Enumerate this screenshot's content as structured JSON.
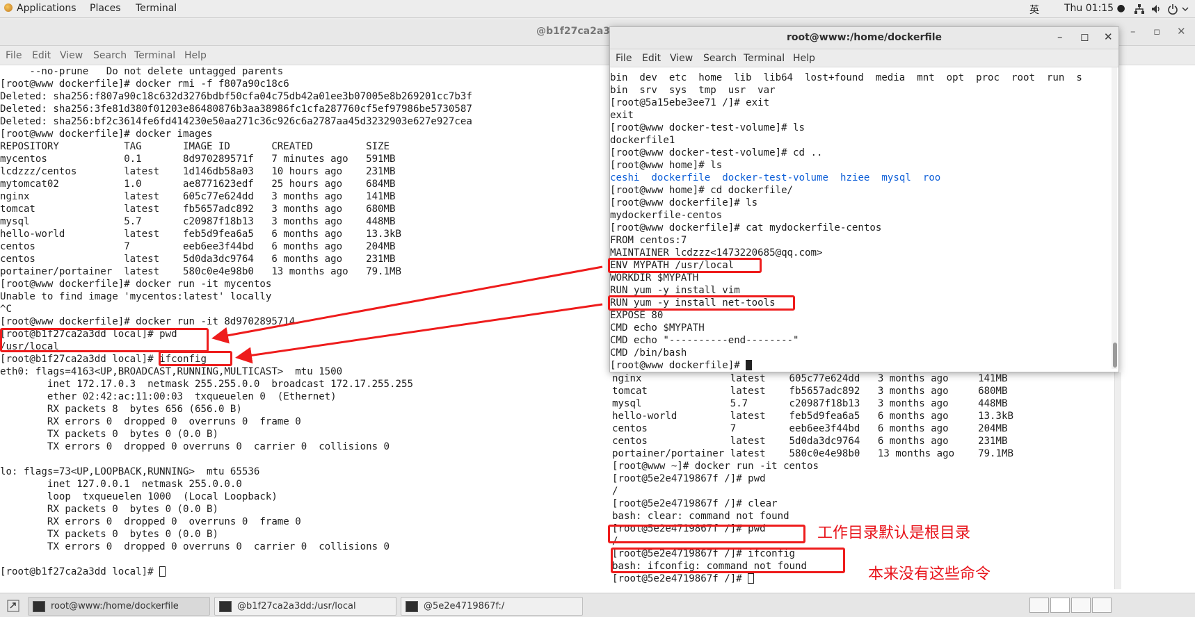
{
  "top_panel": {
    "applications": "Applications",
    "places": "Places",
    "terminal": "Terminal",
    "input_method": "英",
    "clock": "Thu 01:15 ●"
  },
  "main_window": {
    "title": "@b1f27ca2a3dd:/usr/local",
    "title_visible": "@b1f27ca2a3dd",
    "menu": [
      "File",
      "Edit",
      "View",
      "Search",
      "Terminal",
      "Help"
    ],
    "lines": [
      "     --no-prune   Do not delete untagged parents",
      "[root@www dockerfile]# docker rmi -f f807a90c18c6",
      "Deleted: sha256:f807a90c18c632d3276bdbf50cfa04c75db42a01ee3b07005e8b269201cc7b3f",
      "Deleted: sha256:3fe81d380f01203e86480876b3aa38986fc1cfa287760cf5ef97986be5730587",
      "Deleted: sha256:bf2c3614fe6fd414230e50aa271c36c926c6a2787aa45d3232903e627e927cea",
      "[root@www dockerfile]# docker images",
      "REPOSITORY           TAG       IMAGE ID       CREATED         SIZE",
      "mycentos             0.1       8d970289571f   7 minutes ago   591MB",
      "lcdzzz/centos        latest    1d146db58a03   10 hours ago    231MB",
      "mytomcat02           1.0       ae8771623edf   25 hours ago    684MB",
      "nginx                latest    605c77e624dd   3 months ago    141MB",
      "tomcat               latest    fb5657adc892   3 months ago    680MB",
      "mysql                5.7       c20987f18b13   3 months ago    448MB",
      "hello-world          latest    feb5d9fea6a5   6 months ago    13.3kB",
      "centos               7         eeb6ee3f44bd   6 months ago    204MB",
      "centos               latest    5d0da3dc9764   6 months ago    231MB",
      "portainer/portainer  latest    580c0e4e98b0   13 months ago   79.1MB",
      "[root@www dockerfile]# docker run -it mycentos",
      "Unable to find image 'mycentos:latest' locally",
      "^C",
      "[root@www dockerfile]# docker run -it 8d9702895714",
      "[root@b1f27ca2a3dd local]# pwd",
      "/usr/local",
      "[root@b1f27ca2a3dd local]# ifconfig",
      "eth0: flags=4163<UP,BROADCAST,RUNNING,MULTICAST>  mtu 1500",
      "        inet 172.17.0.3  netmask 255.255.0.0  broadcast 172.17.255.255",
      "        ether 02:42:ac:11:00:03  txqueuelen 0  (Ethernet)",
      "        RX packets 8  bytes 656 (656.0 B)",
      "        RX errors 0  dropped 0  overruns 0  frame 0",
      "        TX packets 0  bytes 0 (0.0 B)",
      "        TX errors 0  dropped 0 overruns 0  carrier 0  collisions 0",
      "",
      "lo: flags=73<UP,LOOPBACK,RUNNING>  mtu 65536",
      "        inet 127.0.0.1  netmask 255.0.0.0",
      "        loop  txqueuelen 1000  (Local Loopback)",
      "        RX packets 0  bytes 0 (0.0 B)",
      "        RX errors 0  dropped 0  overruns 0  frame 0",
      "        TX packets 0  bytes 0 (0.0 B)",
      "        TX errors 0  dropped 0 overruns 0  carrier 0  collisions 0",
      "",
      "[root@b1f27ca2a3dd local]# "
    ]
  },
  "dockerfile_window": {
    "title": "root@www:/home/dockerfile",
    "menu": [
      "File",
      "Edit",
      "View",
      "Search",
      "Terminal",
      "Help"
    ],
    "lines_before": [
      "bin  dev  etc  home  lib  lib64  lost+found  media  mnt  opt  proc  root  run  s",
      "bin  srv  sys  tmp  usr  var",
      "[root@5a15ebe3ee71 /]# exit",
      "exit",
      "[root@www docker-test-volume]# ls",
      "dockerfile1",
      "[root@www docker-test-volume]# cd ..",
      "[root@www home]# ls"
    ],
    "ls_home": [
      "ceshi",
      "dockerfile",
      "docker-test-volume",
      "hziee",
      "mysql",
      "roo"
    ],
    "lines_after": [
      "[root@www home]# cd dockerfile/",
      "[root@www dockerfile]# ls",
      "mydockerfile-centos",
      "[root@www dockerfile]# cat mydockerfile-centos",
      "FROM centos:7",
      "MAINTAINER lcdzzz<1473220685@qq.com>",
      "ENV MYPATH /usr/local",
      "WORKDIR $MYPATH",
      "RUN yum -y install vim",
      "RUN yum -y install net-tools",
      "EXPOSE 80",
      "CMD echo $MYPATH",
      "CMD echo \"----------end--------\"",
      "CMD /bin/bash",
      "[root@www dockerfile]# "
    ]
  },
  "background_window": {
    "lines": [
      "nginx               latest    605c77e624dd   3 months ago     141MB",
      "tomcat              latest    fb5657adc892   3 months ago     680MB",
      "mysql               5.7       c20987f18b13   3 months ago     448MB",
      "hello-world         latest    feb5d9fea6a5   6 months ago     13.3kB",
      "centos              7         eeb6ee3f44bd   6 months ago     204MB",
      "centos              latest    5d0da3dc9764   6 months ago     231MB",
      "portainer/portainer latest    580c0e4e98b0   13 months ago    79.1MB",
      "[root@www ~]# docker run -it centos",
      "[root@5e2e4719867f /]# pwd",
      "/",
      "[root@5e2e4719867f /]# clear",
      "bash: clear: command not found",
      "[root@5e2e4719867f /]# pwd",
      "/",
      "[root@5e2e4719867f /]# ifconfig",
      "bash: ifconfig: command not found",
      "[root@5e2e4719867f /]# "
    ]
  },
  "annotations": {
    "workdir_note": "工作目录默认是根目录",
    "no_commands_note": "本来没有这些命令"
  },
  "taskbar": {
    "items": [
      "root@www:/home/dockerfile",
      "@b1f27ca2a3dd:/usr/local",
      "@5e2e4719867f:/"
    ]
  },
  "colors": {
    "annotation": "#ee1c1c",
    "ls_dir": "#1060d8"
  }
}
